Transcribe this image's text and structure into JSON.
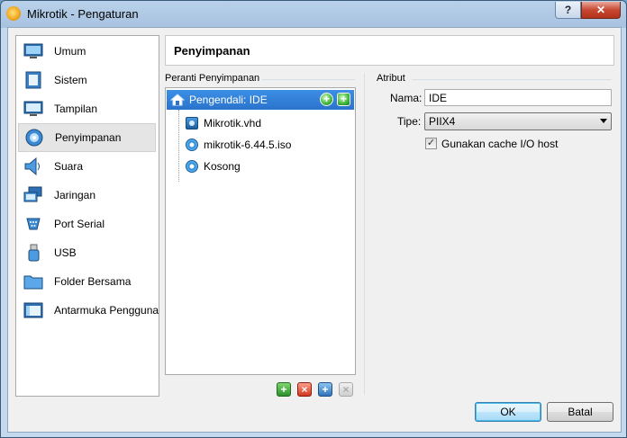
{
  "window": {
    "title": "Mikrotik - Pengaturan",
    "help_label": "?",
    "close_label": "✕"
  },
  "sidebar": {
    "items": [
      {
        "label": "Umum",
        "icon": "monitor-general-icon"
      },
      {
        "label": "Sistem",
        "icon": "system-chip-icon"
      },
      {
        "label": "Tampilan",
        "icon": "display-monitor-icon"
      },
      {
        "label": "Penyimpanan",
        "icon": "storage-disk-icon",
        "active": true
      },
      {
        "label": "Suara",
        "icon": "speaker-icon"
      },
      {
        "label": "Jaringan",
        "icon": "network-icon"
      },
      {
        "label": "Port Serial",
        "icon": "serial-port-icon"
      },
      {
        "label": "USB",
        "icon": "usb-icon"
      },
      {
        "label": "Folder Bersama",
        "icon": "shared-folder-icon"
      },
      {
        "label": "Antarmuka Pengguna",
        "icon": "user-interface-icon"
      }
    ]
  },
  "page": {
    "title": "Penyimpanan"
  },
  "storage": {
    "group_label": "Peranti Penyimpanan",
    "controller": "Pengendali: IDE",
    "items": [
      {
        "label": "Mikrotik.vhd",
        "icon": "hard-disk-icon"
      },
      {
        "label": "mikrotik-6.44.5.iso",
        "icon": "optical-disc-icon"
      },
      {
        "label": "Kosong",
        "icon": "optical-disc-icon"
      }
    ]
  },
  "attributes": {
    "group_label": "Atribut",
    "name_label": "Nama:",
    "name_value": "IDE",
    "type_label": "Tipe:",
    "type_value": "PIIX4",
    "cache_label": "Gunakan cache I/O host",
    "cache_checked": true,
    "check_mark": "✓"
  },
  "buttons": {
    "ok": "OK",
    "cancel": "Batal"
  },
  "colors": {
    "selection": "#2b73cc",
    "window_frame": "#b9d1ea"
  }
}
